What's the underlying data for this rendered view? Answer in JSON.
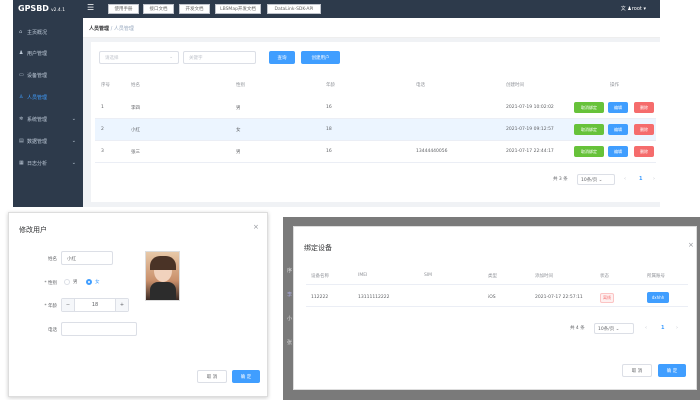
{
  "app": {
    "logo": "GPSBD",
    "version": "v2.4.1",
    "sidebar": [
      {
        "icon": "home-icon",
        "glyph": "⌂",
        "label": "主页概况"
      },
      {
        "icon": "user-icon",
        "glyph": "♟",
        "label": "用户管理"
      },
      {
        "icon": "device-icon",
        "glyph": "▭",
        "label": "设备管理"
      },
      {
        "icon": "person-icon",
        "glyph": "♙",
        "label": "人员管理"
      },
      {
        "icon": "gear-icon",
        "glyph": "✲",
        "label": "系统管理"
      },
      {
        "icon": "data-icon",
        "glyph": "▤",
        "label": "数据管理"
      },
      {
        "icon": "log-icon",
        "glyph": "▦",
        "label": "日志分析"
      }
    ],
    "toplinks": [
      "使用手册",
      "接口文档",
      "开发文档",
      "LBSMap开发文档",
      "DataLink-SDK-API"
    ],
    "user": "root",
    "breadcrumb": {
      "parent": "人员管理",
      "current": "人员管理"
    },
    "filter": {
      "select_placeholder": "请选择",
      "keyword_placeholder": "关键字",
      "query_label": "查询",
      "create_label": "创建用户"
    },
    "table": {
      "headers": [
        "序号",
        "姓名",
        "性别",
        "年龄",
        "电话",
        "创建时间",
        "操作"
      ],
      "rows": [
        {
          "no": "1",
          "name": "李四",
          "gender": "男",
          "age": "16",
          "phone": "",
          "created": "2021-07-19 10:02:02"
        },
        {
          "no": "2",
          "name": "小红",
          "gender": "女",
          "age": "18",
          "phone": "",
          "created": "2021-07-19 09:12:57"
        },
        {
          "no": "3",
          "name": "张三",
          "gender": "男",
          "age": "16",
          "phone": "13444440056",
          "created": "2021-07-17 22:44:17"
        }
      ],
      "actions": {
        "unbind": "取消绑定",
        "edit": "编辑",
        "delete": "删除"
      }
    },
    "pager": {
      "total": "共 3 条",
      "page_size": "10条/页",
      "page": "1"
    }
  },
  "edit_dialog": {
    "title": "修改用户",
    "name_label": "姓名",
    "name_value": "小红",
    "gender_label": "* 性别",
    "male": "男",
    "female": "女",
    "age_label": "* 年龄",
    "age_value": "18",
    "phone_label": "电话",
    "cancel": "取 消",
    "confirm": "确 定",
    "photo_icon": "user-photo"
  },
  "bind_dialog": {
    "title": "绑定设备",
    "headers": [
      "设备名称",
      "IMEI",
      "SIM",
      "类型",
      "添加时间",
      "状态",
      "所属账号"
    ],
    "row": {
      "name": "112222",
      "imei": "13111112222",
      "sim": "",
      "type": "iOS",
      "added": "2021-07-17 22:57:11",
      "status": "离线",
      "account": "dxhhh"
    },
    "pager": {
      "total": "共 4 条",
      "page_size": "10条/页",
      "page": "1"
    },
    "cancel": "取 消",
    "confirm": "确 定",
    "bg_letters": [
      "序",
      "李",
      "小",
      "张"
    ]
  }
}
